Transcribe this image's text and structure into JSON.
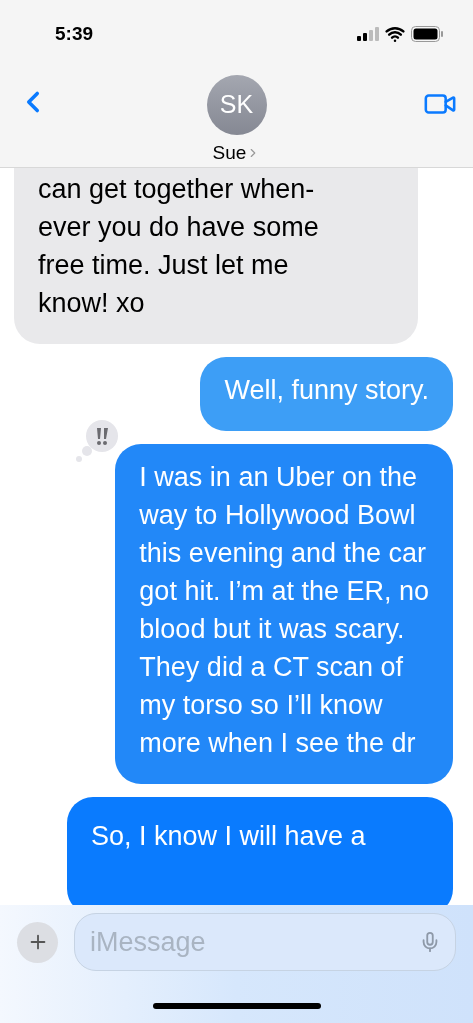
{
  "status_bar": {
    "time": "5:39"
  },
  "header": {
    "initials": "SK",
    "name": "Sue"
  },
  "messages": [
    {
      "kind": "incoming",
      "text": "can get together when-\never you do have some\nfree time. Just let me\nknow! xo",
      "reaction": false,
      "cut_top": true
    },
    {
      "kind": "outgoing",
      "text": "Well, funny story.",
      "reaction": false,
      "cut_top": false
    },
    {
      "kind": "outgoing",
      "text": "I was in an Uber on the\nway to Hollywood Bowl\nthis evening and the car\ngot hit. I’m at the ER, no\nblood but it was scary.\nThey did a CT scan of\nmy torso so I’ll know\nmore when I see the dr",
      "reaction": true,
      "cut_top": false
    },
    {
      "kind": "outgoing",
      "text": "So, I know I will have a",
      "reaction": false,
      "cut_top": false
    }
  ],
  "composer": {
    "placeholder": "iMessage"
  }
}
